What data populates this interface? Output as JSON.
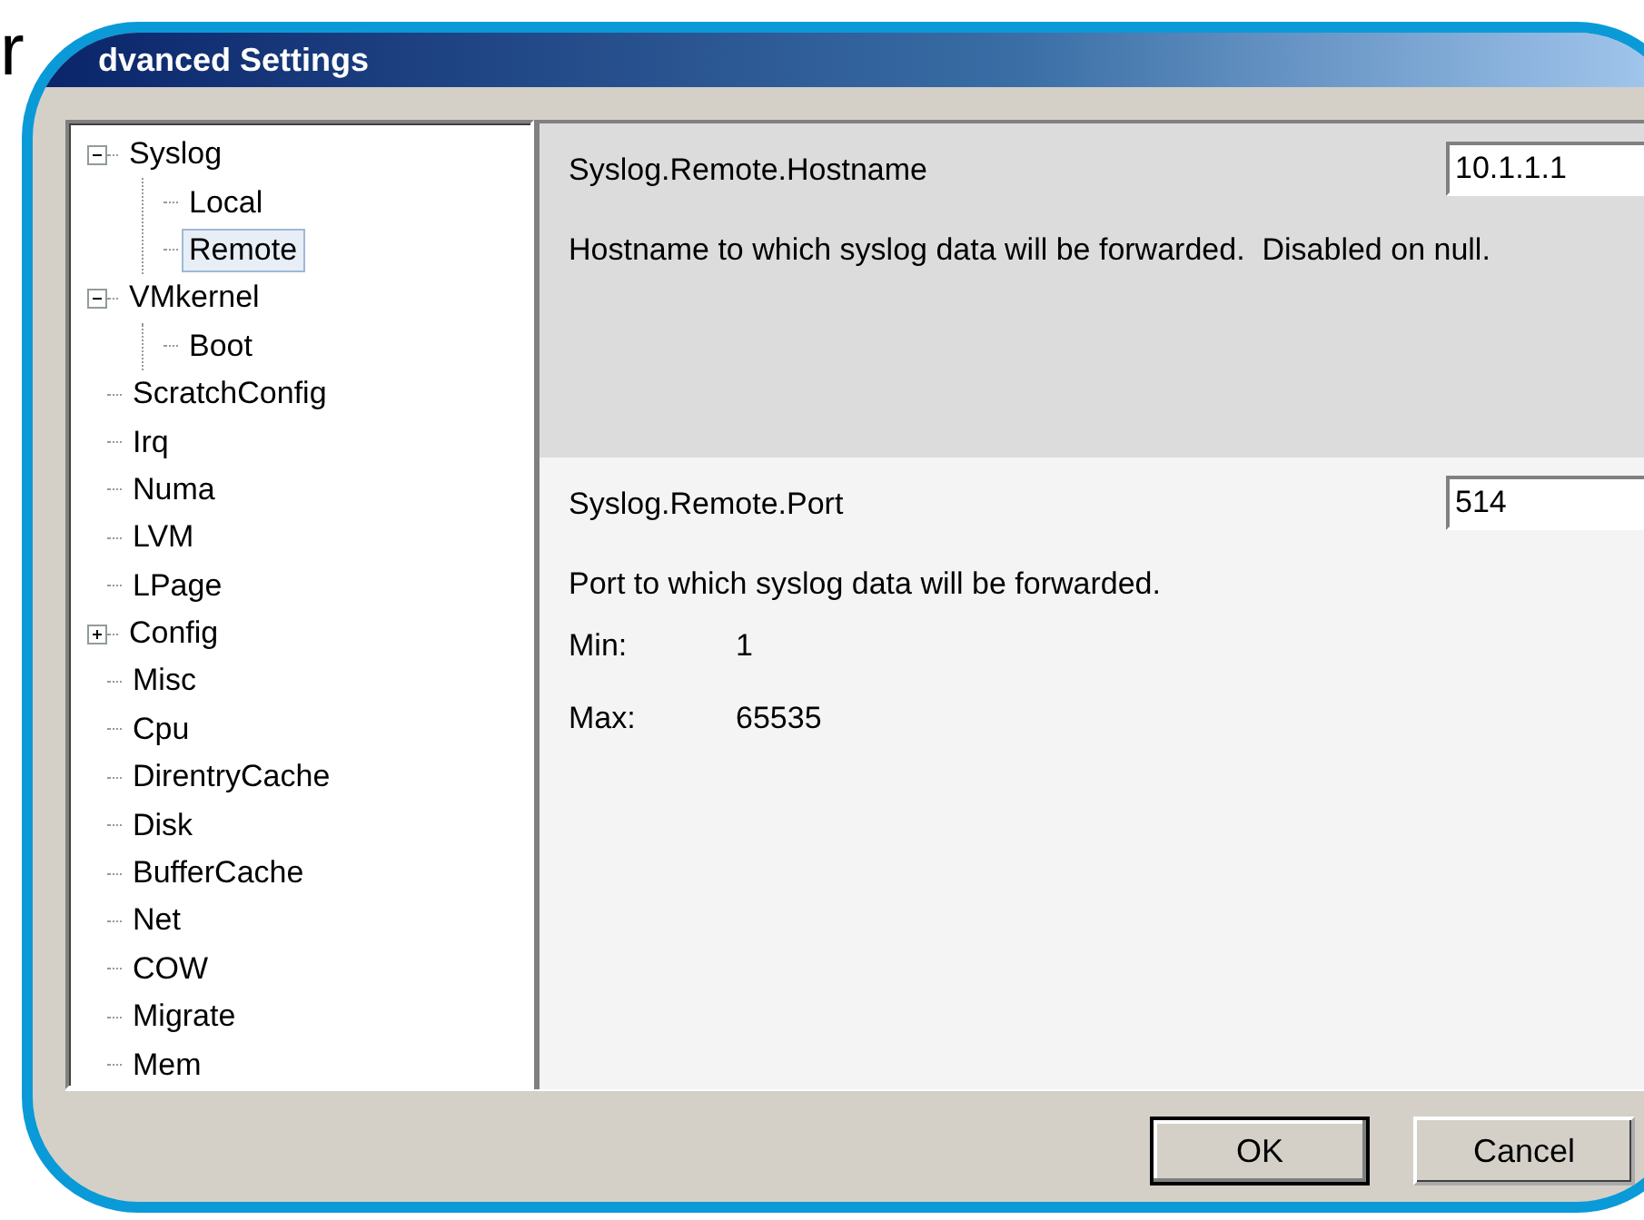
{
  "corner_text": "r",
  "window": {
    "title": "dvanced Settings"
  },
  "tree": [
    {
      "label": "Syslog",
      "expanded": true,
      "selected": false,
      "children": [
        {
          "label": "Local",
          "selected": false
        },
        {
          "label": "Remote",
          "selected": true
        }
      ]
    },
    {
      "label": "VMkernel",
      "expanded": true,
      "selected": false,
      "children": [
        {
          "label": "Boot",
          "selected": false
        }
      ]
    },
    {
      "label": "ScratchConfig",
      "selected": false
    },
    {
      "label": "Irq",
      "selected": false
    },
    {
      "label": "Numa",
      "selected": false
    },
    {
      "label": "LVM",
      "selected": false
    },
    {
      "label": "LPage",
      "selected": false
    },
    {
      "label": "Config",
      "expanded": false,
      "selected": false
    },
    {
      "label": "Misc",
      "selected": false
    },
    {
      "label": "Cpu",
      "selected": false
    },
    {
      "label": "DirentryCache",
      "selected": false
    },
    {
      "label": "Disk",
      "selected": false
    },
    {
      "label": "BufferCache",
      "selected": false
    },
    {
      "label": "Net",
      "selected": false
    },
    {
      "label": "COW",
      "selected": false
    },
    {
      "label": "Migrate",
      "selected": false
    },
    {
      "label": "Mem",
      "selected": false
    }
  ],
  "settings": [
    {
      "name": "Syslog.Remote.Hostname",
      "value": "10.1.1.1",
      "description": "Hostname to which syslog data will be forwarded.  Disabled on null.",
      "selected": true
    },
    {
      "name": "Syslog.Remote.Port",
      "value": "514",
      "description": "Port to which syslog data will be forwarded.",
      "selected": false,
      "min_label": "Min:",
      "min": "1",
      "max_label": "Max:",
      "max": "65535"
    }
  ],
  "buttons": [
    {
      "label": "OK",
      "kind": "default"
    },
    {
      "label": "Cancel",
      "kind": "normal"
    }
  ]
}
